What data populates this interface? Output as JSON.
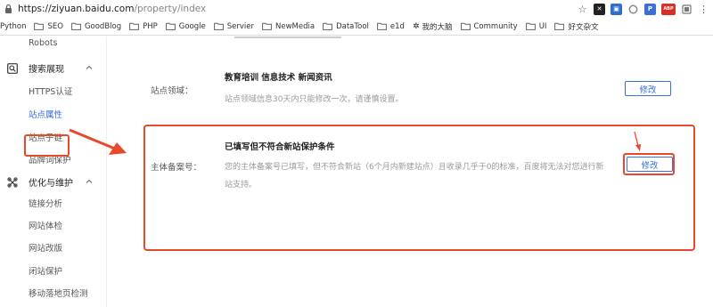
{
  "browser": {
    "url_host": "https://ziyuan.baidu.com",
    "url_path": "/property/index",
    "extension_labels": [
      "ABP"
    ]
  },
  "bookmarks": [
    {
      "label": "Python",
      "folder": false
    },
    {
      "label": "SEO",
      "folder": true
    },
    {
      "label": "GoodBlog",
      "folder": true
    },
    {
      "label": "PHP",
      "folder": true
    },
    {
      "label": "Google",
      "folder": true
    },
    {
      "label": "Servier",
      "folder": true
    },
    {
      "label": "NewMedia",
      "folder": true
    },
    {
      "label": "DataTool",
      "folder": true
    },
    {
      "label": "e1d",
      "folder": true
    },
    {
      "label": "我的大脑",
      "folder": false
    },
    {
      "label": "Community",
      "folder": true
    },
    {
      "label": "UI",
      "folder": true
    },
    {
      "label": "好文杂文",
      "folder": true
    }
  ],
  "sidebar": {
    "robots": "Robots",
    "group_search": "搜索展现",
    "https_auth": "HTTPS认证",
    "site_property": "站点属性",
    "subdomain": "站点子链",
    "brand_protect": "品牌词保护",
    "group_optimize": "优化与维护",
    "link_analysis": "链接分析",
    "site_check": "网站体检",
    "site_revise": "网站改版",
    "close_protect": "闭站保护",
    "mobile_landing": "移动落地页检测"
  },
  "main": {
    "domain_row": {
      "label": "站点领域：",
      "title": "教育培训 信息技术 新闻资讯",
      "desc": "站点领域信息30天内只能修改一次，请谨慎设置。",
      "button": "修改"
    },
    "icp_row": {
      "label": "主体备案号：",
      "title": "已填写但不符合新站保护条件",
      "desc": "您的主体备案号已填写，但不符合新站（6个月内新建站点）且收录几乎于0的标准，百度将无法对您进行新站支持。",
      "button": "修改"
    }
  },
  "colors": {
    "accent": "#3a6fd8",
    "highlight": "#e8492b",
    "active_menu": "#3369e7"
  }
}
